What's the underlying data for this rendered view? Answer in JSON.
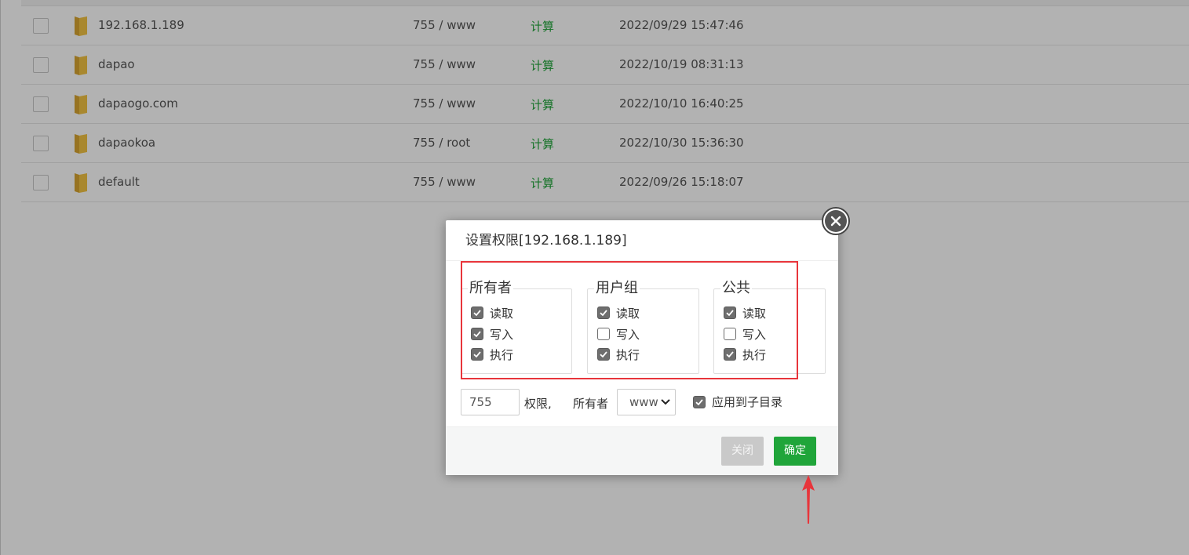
{
  "file_list": {
    "rows": [
      {
        "name": "192.168.1.189",
        "perm": "755 / www",
        "calc": "计算",
        "mtime": "2022/09/29 15:47:46"
      },
      {
        "name": "dapao",
        "perm": "755 / www",
        "calc": "计算",
        "mtime": "2022/10/19 08:31:13"
      },
      {
        "name": "dapaogo.com",
        "perm": "755 / www",
        "calc": "计算",
        "mtime": "2022/10/10 16:40:25"
      },
      {
        "name": "dapaokoa",
        "perm": "755 / root",
        "calc": "计算",
        "mtime": "2022/10/30 15:36:30"
      },
      {
        "name": "default",
        "perm": "755 / www",
        "calc": "计算",
        "mtime": "2022/09/26 15:18:07"
      }
    ]
  },
  "dialog": {
    "title": "设置权限[192.168.1.189]",
    "groups": [
      {
        "legend": "所有者",
        "items": [
          {
            "label": "读取",
            "checked": true
          },
          {
            "label": "写入",
            "checked": true
          },
          {
            "label": "执行",
            "checked": true
          }
        ]
      },
      {
        "legend": "用户组",
        "items": [
          {
            "label": "读取",
            "checked": true
          },
          {
            "label": "写入",
            "checked": false
          },
          {
            "label": "执行",
            "checked": true
          }
        ]
      },
      {
        "legend": "公共",
        "items": [
          {
            "label": "读取",
            "checked": true
          },
          {
            "label": "写入",
            "checked": false
          },
          {
            "label": "执行",
            "checked": true
          }
        ]
      }
    ],
    "mode_value": "755",
    "perm_label": "权限,",
    "owner_label": "所有者",
    "owner_selected": "www",
    "apply_subdir": {
      "label": "应用到子目录",
      "checked": true
    },
    "btn_close": "关闭",
    "btn_ok": "确定"
  },
  "colors": {
    "accent_green": "#20a53a",
    "annotation_red": "#e8353b"
  }
}
